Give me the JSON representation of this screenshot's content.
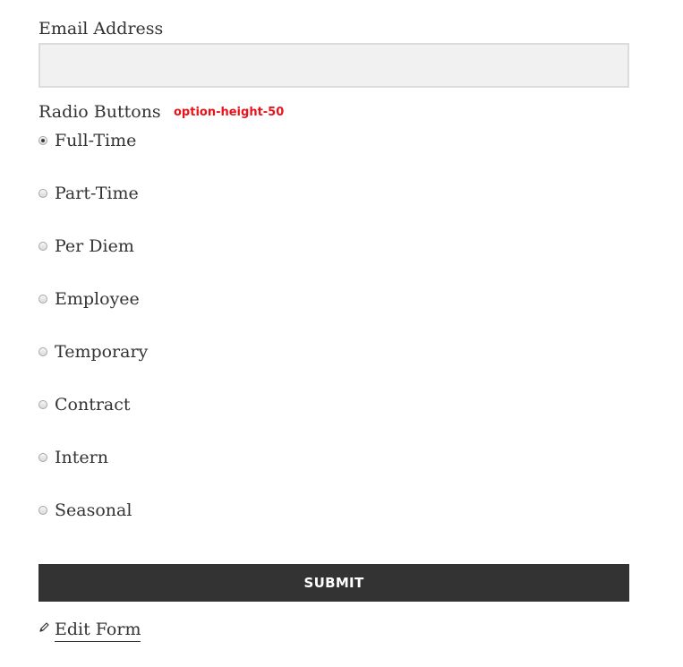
{
  "email_field": {
    "label": "Email Address",
    "value": "",
    "placeholder": ""
  },
  "radio_group": {
    "label": "Radio Buttons",
    "annotation": "option-height-50",
    "annotation_color": "#e8141b",
    "selected": "Full-Time",
    "options": [
      {
        "label": "Full-Time",
        "checked": true
      },
      {
        "label": "Part-Time",
        "checked": false
      },
      {
        "label": "Per Diem",
        "checked": false
      },
      {
        "label": "Employee",
        "checked": false
      },
      {
        "label": "Temporary",
        "checked": false
      },
      {
        "label": "Contract",
        "checked": false
      },
      {
        "label": "Intern",
        "checked": false
      },
      {
        "label": "Seasonal",
        "checked": false
      }
    ]
  },
  "submit_button": {
    "label": "SUBMIT",
    "background": "#333333"
  },
  "edit_link": {
    "label": "Edit Form",
    "icon": "pencil-icon"
  }
}
